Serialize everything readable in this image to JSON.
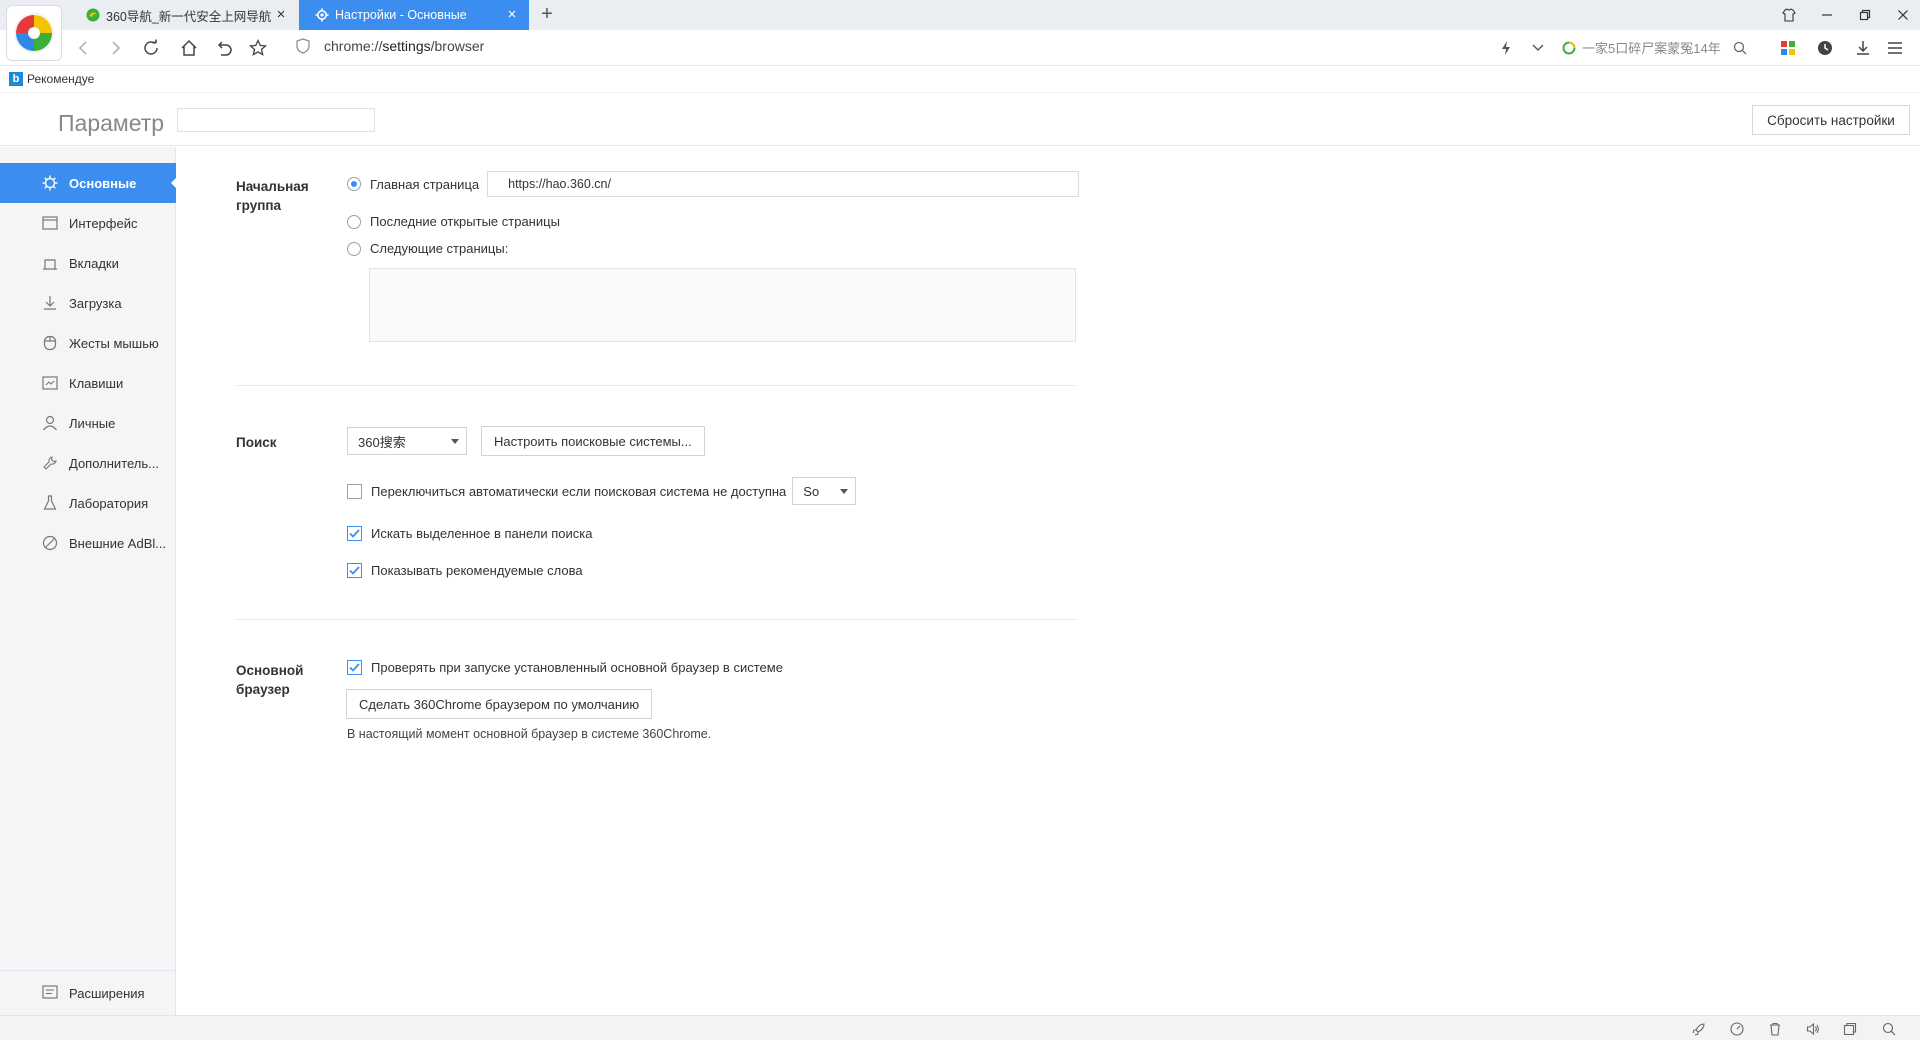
{
  "tabs": [
    {
      "label": "360导航_新一代安全上网导航",
      "close": "×",
      "icon": "360-nav-icon"
    },
    {
      "label": "Настройки - Основные",
      "close": "×",
      "icon": "gear-icon"
    }
  ],
  "new_tab": "+",
  "address": {
    "scheme": "chrome://",
    "host": "settings",
    "path": "/browser"
  },
  "search_box": {
    "placeholder": "一家5口碎尸案蒙冤14年"
  },
  "bookmarks": [
    {
      "label": "Рекомендуе",
      "icon": "bing-icon"
    }
  ],
  "header": {
    "title": "Параметр",
    "search_placeholder": "",
    "reset_label": "Сбросить настройки"
  },
  "sidebar": {
    "items": [
      {
        "label": "Основные",
        "icon": "gear-icon",
        "active": true
      },
      {
        "label": "Интерфейс",
        "icon": "window-icon"
      },
      {
        "label": "Вкладки",
        "icon": "tab-icon"
      },
      {
        "label": "Загрузка",
        "icon": "download-icon"
      },
      {
        "label": "Жесты мышью",
        "icon": "mouse-icon"
      },
      {
        "label": "Клавиши",
        "icon": "keyboard-icon"
      },
      {
        "label": "Личные",
        "icon": "user-icon"
      },
      {
        "label": "Дополнитель...",
        "icon": "wrench-icon"
      },
      {
        "label": "Лаборатория",
        "icon": "flask-icon"
      },
      {
        "label": "Внешние AdBl...",
        "icon": "block-icon"
      }
    ],
    "footer": {
      "label": "Расширения",
      "icon": "extension-icon"
    }
  },
  "startup": {
    "label": "Начальная группа",
    "home_label": "Главная страница",
    "home_url": "https://hao.360.cn/",
    "last_label": "Последние открытые страницы",
    "next_label": "Следующие страницы:",
    "selected": "home"
  },
  "search": {
    "label": "Поиск",
    "engine": "360搜索",
    "manage_label": "Настроить поисковые системы...",
    "auto_switch_label": "Переключиться автоматически если поисковая система не доступна",
    "auto_switch_checked": false,
    "fallback_engine": "So",
    "search_selected_label": "Искать выделенное в панели поиска",
    "search_selected_checked": true,
    "suggest_label": "Показывать рекомендуемые слова",
    "suggest_checked": true
  },
  "default_browser": {
    "label": "Основной браузер",
    "check_label": "Проверять при запуске установленный основной браузер в системе",
    "check_checked": true,
    "make_default_label": "Сделать 360Chrome браузером по умолчанию",
    "status": "В настоящий момент основной браузер в системе 360Chrome."
  },
  "colors": {
    "accent": "#3b8ef0",
    "sidebar_bg": "#f4f5f7"
  }
}
